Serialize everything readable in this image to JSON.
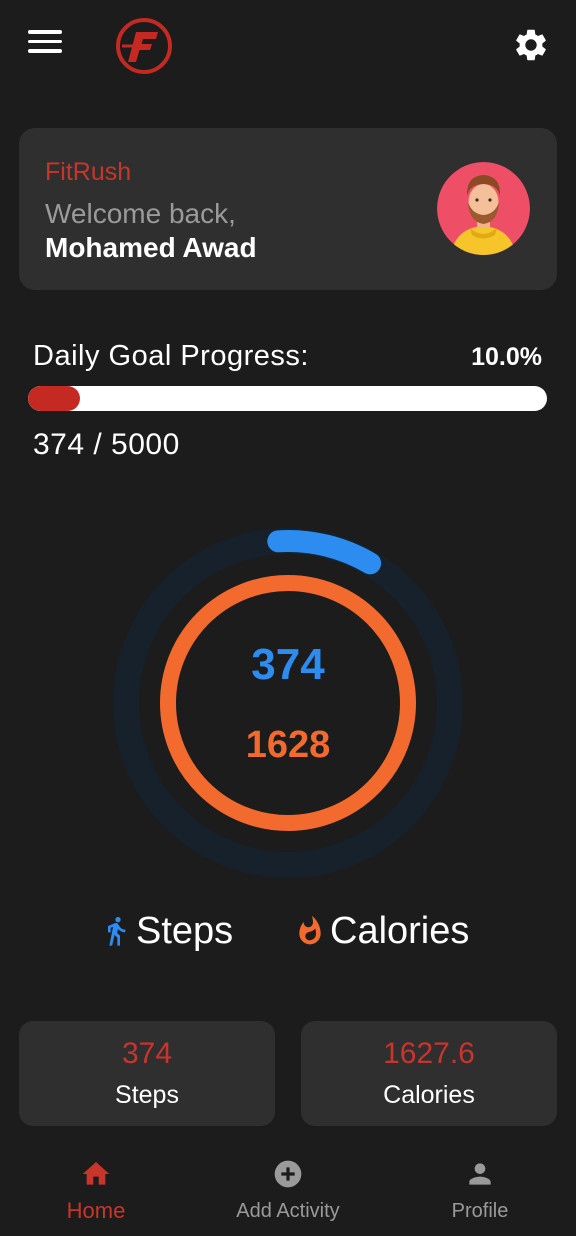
{
  "app": {
    "brand": "FitRush"
  },
  "header": {
    "welcome": "Welcome back,",
    "username": "Mohamed Awad"
  },
  "goal": {
    "label": "Daily Goal Progress:",
    "percent_text": "10.0%",
    "progress": 0.1,
    "count_text": "374 / 5000"
  },
  "rings": {
    "steps_value": "374",
    "calories_value": "1628",
    "steps_arc_fraction": 0.075,
    "steps_color": "#2d8cf0",
    "calories_color": "#f26a2e"
  },
  "legend": {
    "steps_label": "Steps",
    "calories_label": "Calories"
  },
  "stats": [
    {
      "value": "374",
      "label": "Steps"
    },
    {
      "value": "1627.6",
      "label": "Calories"
    }
  ],
  "nav": [
    {
      "label": "Home",
      "icon": "home-icon",
      "active": true
    },
    {
      "label": "Add Activity",
      "icon": "add-circle-icon",
      "active": false
    },
    {
      "label": "Profile",
      "icon": "person-icon",
      "active": false
    }
  ],
  "colors": {
    "accent": "#c8352b",
    "background": "#1c1c1c",
    "card": "#2f2f2f"
  }
}
